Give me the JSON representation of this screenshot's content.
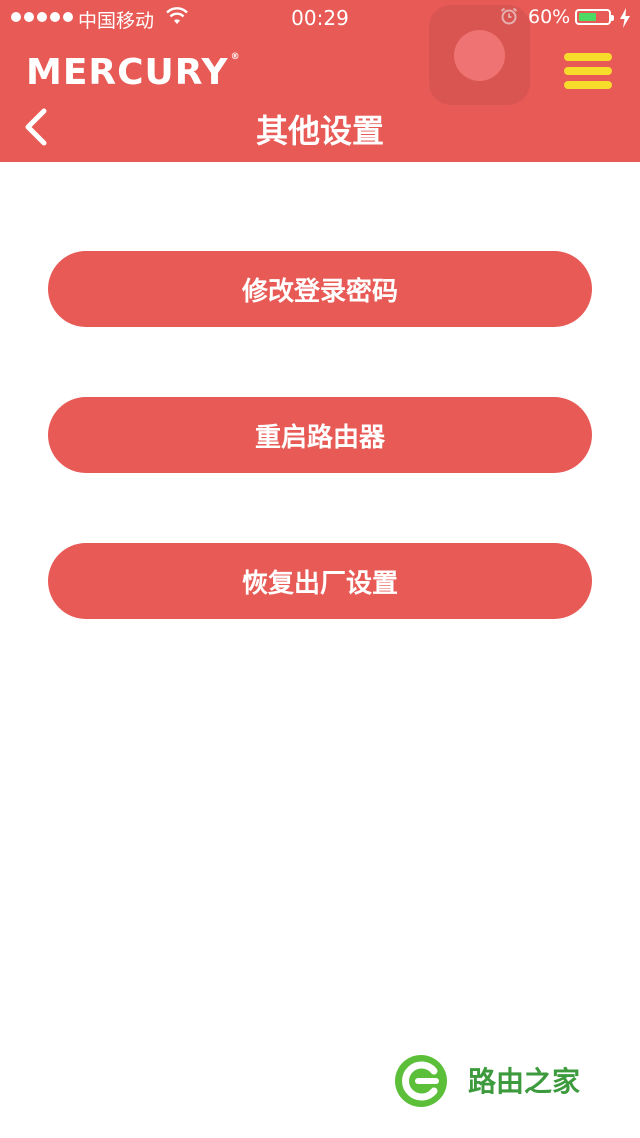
{
  "status_bar": {
    "carrier": "中国移动",
    "time": "00:29",
    "battery_percent": "60%",
    "battery_level": 0.6
  },
  "header": {
    "brand": "MERCURY",
    "title": "其他设置"
  },
  "buttons": {
    "change_password": "修改登录密码",
    "reboot_router": "重启路由器",
    "factory_reset": "恢复出厂设置"
  },
  "watermark": {
    "text": "路由之家"
  },
  "colors": {
    "accent": "#e85a55",
    "menu_icon": "#f7dc2b",
    "battery": "#4cd964",
    "watermark": "#3d9a3d"
  },
  "icons": {
    "back": "chevron-left-icon",
    "menu": "hamburger-menu-icon",
    "wifi": "wifi-icon",
    "alarm": "alarm-icon",
    "battery": "battery-icon",
    "charging": "lightning-icon"
  }
}
